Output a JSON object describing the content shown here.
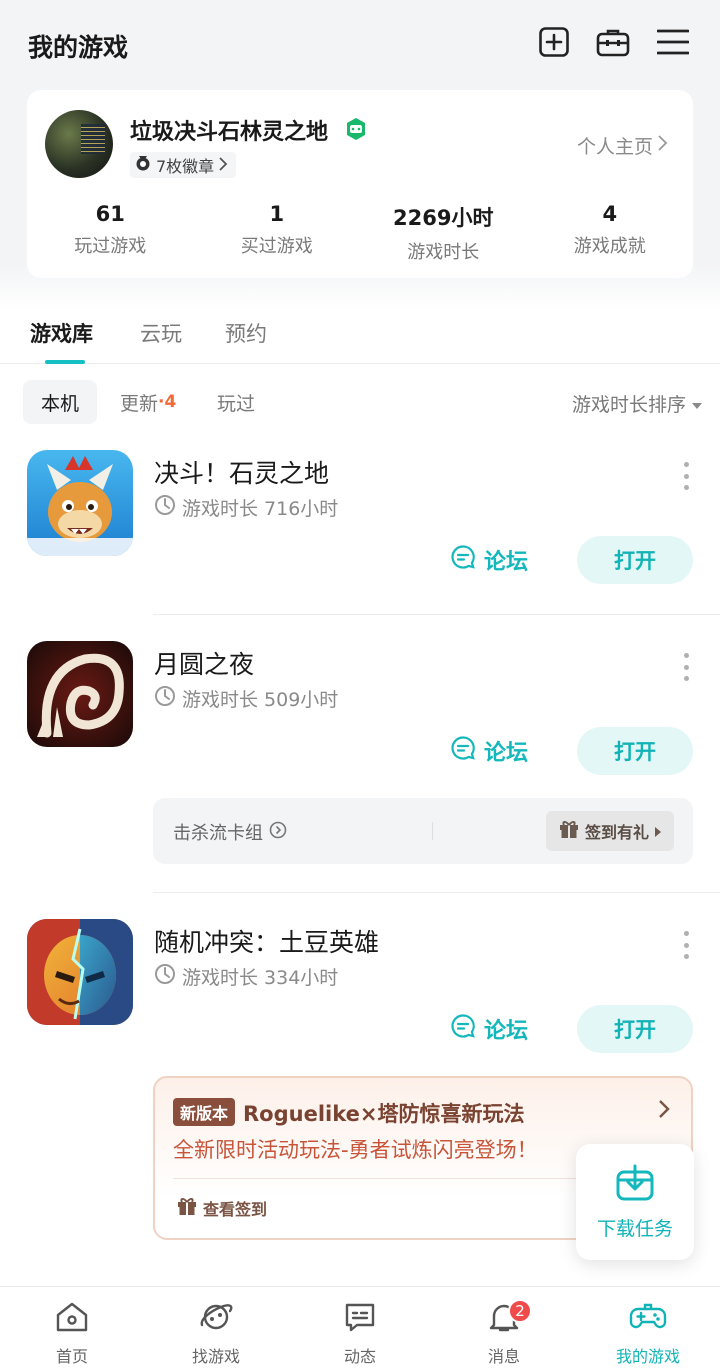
{
  "header": {
    "title": "我的游戏"
  },
  "profile": {
    "username": "垃圾决斗石林灵之地",
    "badges_label": "7枚徽章",
    "homepage_label": "个人主页",
    "stats": [
      {
        "value": "61",
        "label": "玩过游戏"
      },
      {
        "value": "1",
        "label": "买过游戏"
      },
      {
        "value": "2269小时",
        "label": "游戏时长"
      },
      {
        "value": "4",
        "label": "游戏成就"
      }
    ]
  },
  "tabs": [
    {
      "label": "游戏库",
      "active": true
    },
    {
      "label": "云玩",
      "active": false
    },
    {
      "label": "预约",
      "active": false
    }
  ],
  "filters": {
    "local": "本机",
    "updates": "更新",
    "updates_count": "·4",
    "played": "玩过",
    "sort": "游戏时长排序"
  },
  "games": [
    {
      "name": "决斗！石灵之地",
      "playtime": "游戏时长 716小时",
      "forum_label": "论坛",
      "open_label": "打开"
    },
    {
      "name": "月圆之夜",
      "playtime": "游戏时长 509小时",
      "forum_label": "论坛",
      "open_label": "打开"
    },
    {
      "name": "随机冲突：土豆英雄",
      "playtime": "游戏时长 334小时",
      "forum_label": "论坛",
      "open_label": "打开"
    }
  ],
  "deck_bar": {
    "label": "击杀流卡组",
    "checkin_label": "签到有礼"
  },
  "promo": {
    "tag": "新版本",
    "title": "Roguelike×塔防惊喜新玩法",
    "subtitle": "全新限时活动玩法-勇者试炼闪亮登场！",
    "action_label": "查看签到"
  },
  "download_fab": {
    "label": "下载任务"
  },
  "bottom_nav": {
    "items": [
      {
        "label": "首页",
        "icon": "home-icon"
      },
      {
        "label": "找游戏",
        "icon": "planet-icon"
      },
      {
        "label": "动态",
        "icon": "chat-card-icon"
      },
      {
        "label": "消息",
        "icon": "bell-icon",
        "badge": "2"
      },
      {
        "label": "我的游戏",
        "icon": "gamepad-icon",
        "active": true
      }
    ]
  },
  "colors": {
    "accent": "#14c0c4",
    "badge_red": "#ef4b4b",
    "promo_brown": "#8a4f3c"
  }
}
